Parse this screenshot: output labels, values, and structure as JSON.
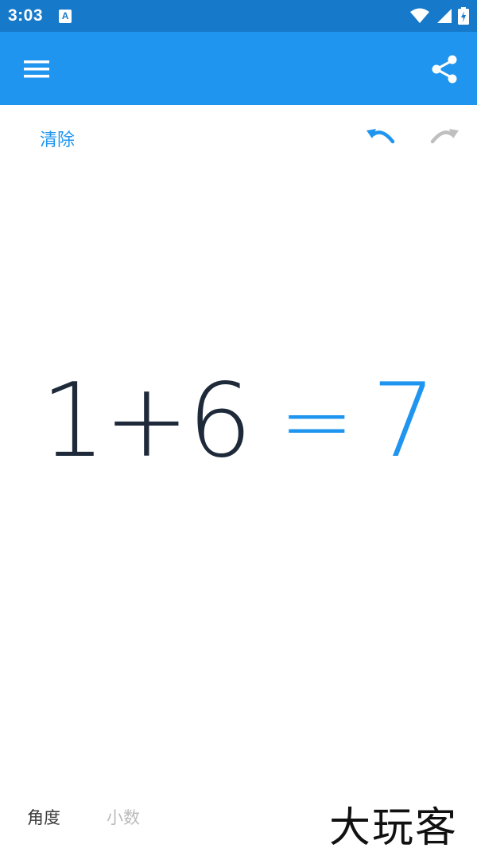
{
  "status_bar": {
    "time": "3:03",
    "notification_icon": "A",
    "icons": [
      "wifi-icon",
      "signal-icon",
      "battery-icon"
    ]
  },
  "app_bar": {
    "menu_icon": "menu-icon",
    "share_icon": "share-icon",
    "color": "#1f95ef"
  },
  "actions": {
    "clear_label": "清除",
    "undo_icon": "undo-icon",
    "redo_icon": "redo-icon"
  },
  "expression": {
    "input": "1+6",
    "equals": "=",
    "result": "7"
  },
  "modes": {
    "angle_label": "角度",
    "decimal_label": "小数"
  },
  "watermark": "大玩客"
}
